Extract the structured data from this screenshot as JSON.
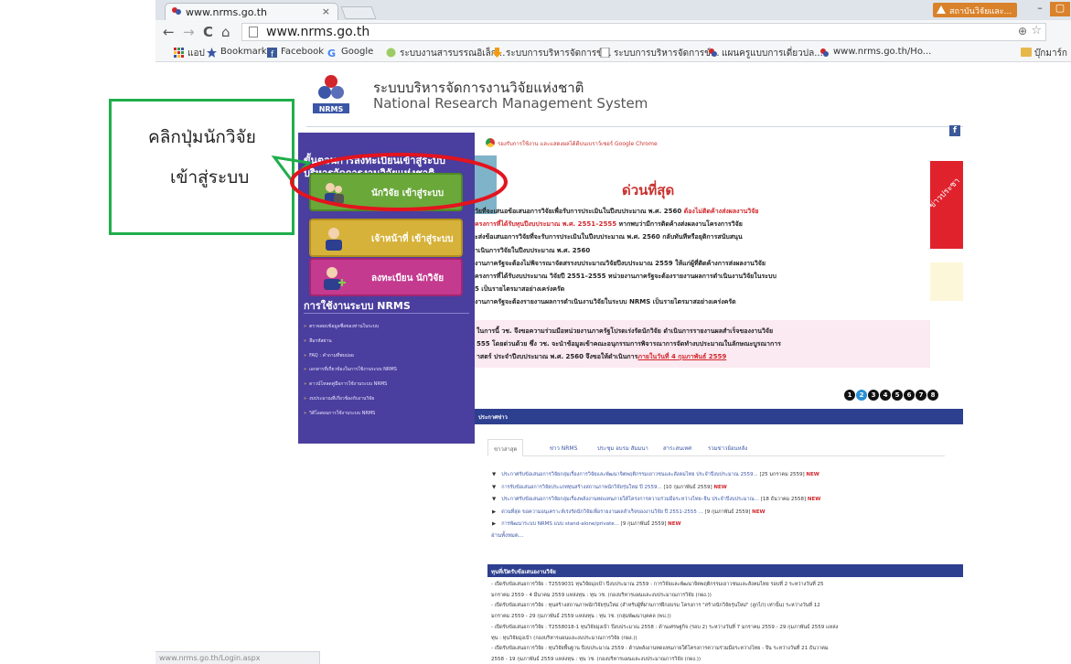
{
  "browser": {
    "tab_title": "www.nrms.go.th",
    "tab_close": "×",
    "user_chip": "สถาบันวิจัยและ...",
    "win_min": "–",
    "win_max": "▢",
    "nav_back": "←",
    "nav_forward": "→",
    "nav_reload": "C",
    "nav_home": "⌂",
    "address": "www.nrms.go.th",
    "zoom_icon": "⊕",
    "star_icon": "☆",
    "bookmarks": [
      "แอป",
      "Bookmarks",
      "Facebook",
      "Google",
      "ระบบงานสารบรรณอิเล็ก...",
      "ระบบการบริหารจัดการข์...",
      "ระบบการบริหารจัดการข์...",
      "แผนครูแบบการเดี่ยวปล...",
      "www.nrms.go.th/Ho..."
    ],
    "bookmark_other": "บุ๊กมาร์ก",
    "status_url": "www.nrms.go.th/Login.aspx"
  },
  "header": {
    "logo_text": "NRMS",
    "title_th": "ระบบบริหารจัดการงานวิจัยแห่งชาติ",
    "title_en": "National Research Management System"
  },
  "sidebar": {
    "heading": "ขั้นตอนการลงทะเบียนเข้าสู่ระบบ บริหารจัดการงานวิจัยแห่งชาติ",
    "buttons": [
      {
        "label": "นักวิจัย เข้าสู่ระบบ"
      },
      {
        "label": "เจ้าหน้าที่ เข้าสู่ระบบ"
      },
      {
        "label": "ลงทะเบียน นักวิจัย"
      }
    ],
    "section_title": "การใช้งานระบบ NRMS",
    "links": [
      "ตรวจสอบข้อมูลชื่อของท่านในระบบ",
      "ลืมรหัสผ่าน",
      "FAQ : คำถามที่พบบ่อย",
      "เอกสารที่เกี่ยวข้องในการใช้งานระบบ NRMS",
      "ดาวน์โหลดคู่มือการใช้งานระบบ NRMS",
      "งบประมาณที่เกี่ยวข้องกับงานวิจัย",
      "วิดีโอสอนการใช้งานระบบ NRMS"
    ],
    "link_chevron": "»"
  },
  "main": {
    "facebook_icon": "f",
    "chrome_note": "รองรับการใช้งาน และแสดงผลได้ดีบนเบราว์เซอร์ Google Chrome",
    "urgent_title": "ด่วนที่สุด",
    "red_tab_text": "ข่าวประชา",
    "notice_lines": [
      {
        "text": "วัยที่จะเสนอข้อเสนอการวิจัยเพื่อรับการประเมินในปีงบประมาณ พ.ศ. 2560 ",
        "red": "ต้องไม่ติดค้างส่งผลงานวิจัย"
      },
      {
        "text": "",
        "red": "ครงการที่ได้รับทุนปีงบประมาณ พ.ศ. 2551–2555",
        "tail": " หากพบว่ามีการติดค้างส่งผลงานโครงการวิจัย"
      },
      {
        "text": "ะส่งข้อเสนอการวิจัยที่จะรับการประเมินในปีงบประมาณ พ.ศ. 2560 กลับทันทีหรือยุติการสนับสนุน"
      },
      {
        "text": "าเนินการวิจัยในปีงบประมาณ พ.ศ. 2560"
      },
      {
        "text": "งานภาครัฐจะต้องไม่พิจารณาจัดสรรงบประมาณวิจัยปีงบประมาณ 2559 ให้แก่ผู้ที่ติดค้างการส่งผลงานวิจัย"
      },
      {
        "text": "ครงการที่ได้รับงบประมาณ วิจัยปี 2551–2555 หน่วยงานภาครัฐจะต้องรายงานผลการดำเนินงานวิจัยในระบบ"
      },
      {
        "text": "5 เป็นรายไตรมาสอย่างเคร่งครัด"
      },
      {
        "text": "งานภาครัฐจะต้องรายงานผลการดำเนินงานวิจัยในระบบ NRMS เป็นรายไตรมาสอย่างเคร่งครัด"
      }
    ],
    "pink_lines": [
      {
        "text": "   ในการนี้ วช. จึงขอความร่วมมือหน่วยงานภาครัฐโปรดเร่งรัดนักวิจัย ดำเนินการรายงานผลสำเร็จของงานวิจัย"
      },
      {
        "text": "555 โดยด่วนด้วย ซึ่ง วช. จะนำข้อมูลเข้าคณะอนุกรรมการพิจารณาการจัดทำงบประมาณในลักษณะบูรณาการ"
      },
      {
        "text": "าสตร์ ประจำปีงบประมาณ พ.ศ. 2560 จึงขอให้ดำเนินการ",
        "ul": "ภายในวันที่  4 กุมภาพันธ์ 2559"
      }
    ],
    "pager": [
      "1",
      "2",
      "3",
      "4",
      "5",
      "6",
      "7",
      "8"
    ],
    "pager_active": 2,
    "news_title": "ประกาศข่าว",
    "news_tabs": [
      "ข่าวล่าสุด",
      "ข่าว NRMS",
      "ประชุม อบรม สัมมนา",
      "สาระสนเทศ",
      "รวมข่าวย้อนหลัง"
    ],
    "news_items": [
      {
        "bullet": "▼",
        "text": "ประกาศรับข้อเสนอการวิจัยกลุ่มเรื่องการวิจัยและพัฒนาจิตพฤติกรรมเยาวชนและสังคมไทย ประจำปีงบประมาณ 2559...",
        "date": "[25 มกราคม 2559]",
        "new": "NEW"
      },
      {
        "bullet": "▼",
        "text": "การรับข้อเสนอการวิจัยประเภททุนสร้างสถานภาพนักวิจัยรุ่นใหม่ ปี 2559...",
        "date": "[10 กุมภาพันธ์ 2559]",
        "new": "NEW"
      },
      {
        "bullet": "▼",
        "text": "ประกาศรับข้อเสนอการวิจัยกลุ่มเรื่องพลังงานทดแทนภายใต้โครงการความร่วมมือระหว่างไทย–จีน ประจำปีงบประมาณ...",
        "date": "[18 ธันวาคม 2558]",
        "new": "NEW"
      },
      {
        "bullet": "▶",
        "text": "ด่วนที่สุด ขอความอนุเคราะห์เร่งรัดนักวิจัยเพื่อรายงานผลสำเร็จของงานวิจัย ปี 2551-2555 ...",
        "date": "[9 กุมภาพันธ์ 2559]",
        "new": "NEW"
      },
      {
        "bullet": "▶",
        "text": "การพัฒนาระบบ NRMS แบบ stand-alone/private...",
        "date": "[9 กุมภาพันธ์ 2559]",
        "new": "NEW"
      }
    ],
    "news_all": "อ่านทั้งหมด...",
    "fund_title": "ทุนที่เปิดรับข้อเสนองานวิจัย",
    "fund_lines": [
      "- เปิดรับข้อเสนอการวิจัย : T2559031 ทุนวิจัยมุ่งเป้า ปีงบประมาณ 2559 : การวิจัยและพัฒนาจิตพฤติกรรมเยาวชนและสังคมไทย รอบที่ 2 ระหว่างวันที่ 25",
      "มกราคม 2559 - 4 มีนาคม 2559 แหล่งทุน : ทุน วช. (กองบริหารแผนและงบประมาณการวิจัย (กผง.))",
      "- เปิดรับข้อเสนอการวิจัย : ทุนสร้างสถานภาพนักวิจัยรุ่นใหม่ (สำหรับผู้ที่ผ่านการฝึกอบรม โครงการ \"สร้างนักวิจัยรุ่นใหม่\" (ลูกไก่) เท่านั้น) ระหว่างวันที่ 12",
      "มกราคม 2559 - 29 กุมภาพันธ์ 2559 แหล่งทุน : ทุน วช. (กลุ่มพัฒนาบุคคล (พบ.))",
      "- เปิดรับข้อเสนอการวิจัย : T2558018-1 ทุนวิจัยมุ่งเป้า ปีงบประมาณ 2558 : ด้านเศรษฐกิจ (รอบ 2) ระหว่างวันที่ 7 มกราคม 2559 - 29 กุมภาพันธ์ 2559 แหล่ง",
      "ทุน : ทุนวิจัยมุ่งเป้า (กองบริหารแผนและงบประมาณการวิจัย (กผง.))",
      "- เปิดรับข้อเสนอการวิจัย : ทุนวิจัยพื้นฐาน ปีงบประมาณ 2559 : ด้านพลังงานทดแทนภายใต้โครงการความร่วมมือระหว่างไทย - จีน ระหว่างวันที่ 21 ธันวาคม",
      "2558 - 19 กุมภาพันธ์ 2559 แหล่งทุน : ทุน วช. (กองบริหารแผนและงบประมาณการวิจัย (กผง.))"
    ]
  },
  "annotation": {
    "line1": "คลิกปุ่มนักวิจัย",
    "line2": "เข้าสู่ระบบ",
    "green": "#1fae4b",
    "red": "#e3141e"
  }
}
